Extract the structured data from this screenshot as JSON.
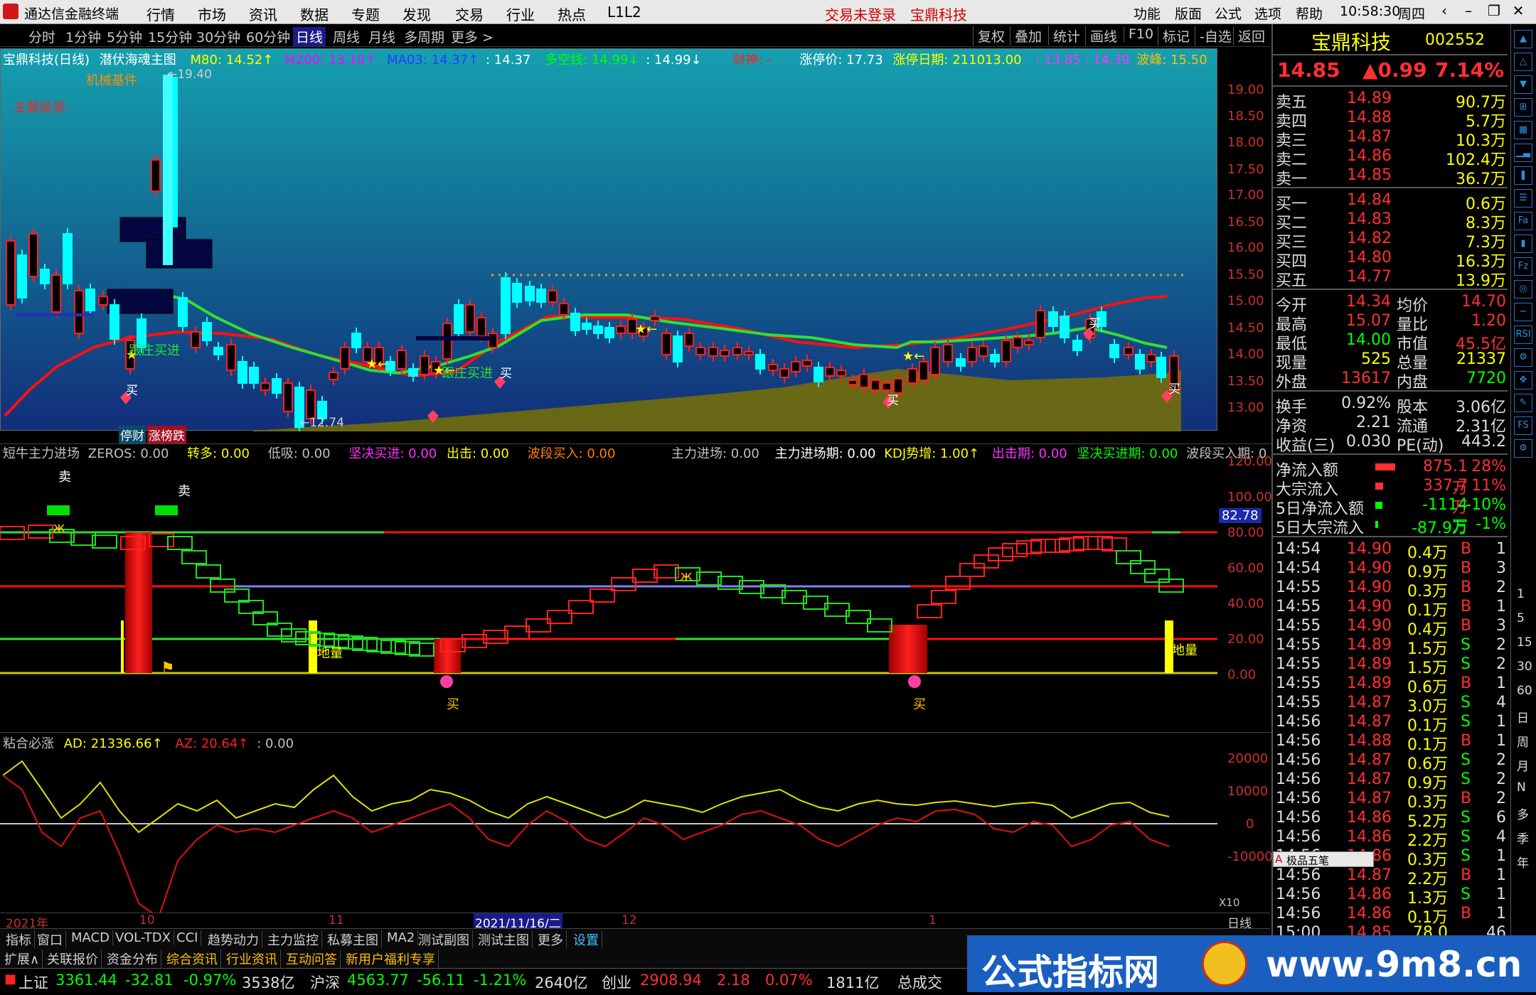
{
  "titlebar": {
    "app_name": "通达信金融终端",
    "menus": [
      "行情",
      "市场",
      "资讯",
      "数据",
      "专题",
      "发现",
      "交易",
      "行业",
      "热点",
      "L1L2"
    ],
    "notice": "交易未登录",
    "stock_short": "宝鼎科技",
    "right_menus": [
      "功能",
      "版面",
      "公式",
      "选项",
      "帮助"
    ],
    "time": "10:58:30",
    "weekday": "周四"
  },
  "toolbar": {
    "periods": [
      "分时",
      "1分钟",
      "5分钟",
      "15分钟",
      "30分钟",
      "60分钟",
      "日线",
      "周线",
      "月线",
      "多周期",
      "更多 >"
    ],
    "active_period": "日线",
    "right_buttons": [
      "复权",
      "叠加",
      "统计",
      "画线",
      "F10",
      "标记",
      "-自选",
      "返回"
    ]
  },
  "main": {
    "stock_title": "宝鼎科技(日线)",
    "formula": "潜伏海魂主图",
    "m80": "M80: 14.52↑",
    "m200": "M200: 13.10↑",
    "ma03": "MA03: 14.37↑",
    "v1": ": 14.37",
    "duokong": "多空线: 14.99↓",
    "v2": ": 14.99↓",
    "caishen": "财神: -",
    "zhangting": "涨停价: 17.73",
    "zhangting_date": "涨停日期: 211013.00",
    "range": ": 13.85 : 14.39",
    "bofeng": "波峰: 15.50",
    "label_jixie": "机械基件",
    "label_zhuti": "主题投资:",
    "label_high": "←19.40",
    "label_low": "←12.74",
    "label_track1": "跟庄买进",
    "label_track2": "跟庄买进",
    "label_buy": "买",
    "label_stop": "停财",
    "label_rank": "涨榜跌",
    "y_ticks": [
      "19.00",
      "18.50",
      "18.00",
      "17.50",
      "17.00",
      "16.50",
      "16.00",
      "15.50",
      "15.00",
      "14.50",
      "14.00",
      "13.50",
      "13.00"
    ]
  },
  "sub1": {
    "title": "短牛主力进场",
    "items": [
      "ZEROS: 0.00",
      "转多: 0.00",
      "低吸: 0.00",
      "坚决买进: 0.00",
      "出击: 0.00",
      "波段买入: 0.00",
      "主力进场: 0.00",
      "主力进场期: 0.00",
      "KDJ势增: 1.00↑",
      "出击期: 0.00",
      "坚决买进期: 0.00",
      "波段买入期: 0"
    ],
    "y_ticks": [
      "120.00",
      "100.00",
      "80.00",
      "60.00",
      "40.00",
      "20.00",
      "0.00"
    ],
    "current_value": "82.78",
    "sell_label": "卖",
    "buy_label": "买",
    "dig_label": "地量"
  },
  "sub2": {
    "title": "粘合必涨",
    "ad": "AD: 21336.66↑",
    "az": "AZ: 20.64↑",
    "extra": ": 0.00",
    "y_ticks": [
      "20000",
      "10000",
      "0",
      "-10000"
    ],
    "unit": "X10"
  },
  "timeaxis": {
    "labels": [
      "2021年",
      "10",
      "11",
      "2021/11/16/二",
      "12",
      "1"
    ],
    "period": "日线"
  },
  "tabs1": [
    "指标",
    "窗口",
    "MACD",
    "VOL-TDX",
    "CCI",
    "趋势动力",
    "主力监控",
    "私募主图",
    "MA2",
    "测试副图",
    "测试主图",
    "更多",
    "设置"
  ],
  "tabs2": [
    "扩展∧",
    "关联报价",
    "资金分布",
    "综合资讯",
    "行业资讯",
    "互动问答",
    "新用户福利专享"
  ],
  "status": {
    "sh_name": "上证",
    "sh_val": "3361.44",
    "sh_chg": "-32.81",
    "sh_pct": "-0.97%",
    "sh_amt": "3538亿",
    "hs_name": "沪深",
    "hs_val": "4563.77",
    "hs_chg": "-56.11",
    "hs_pct": "-1.21%",
    "hs_amt": "2640亿",
    "cy_name": "创业",
    "cy_val": "2908.94",
    "cy_chg": "2.18",
    "cy_pct": "0.07%",
    "cy_amt": "1811亿",
    "total": "总成交"
  },
  "quote": {
    "name": "宝鼎科技",
    "code": "002552",
    "price": "14.85",
    "change": "▲0.99",
    "pct": "7.14%",
    "asks": [
      {
        "label": "卖五",
        "price": "14.89",
        "vol": "90.7万"
      },
      {
        "label": "卖四",
        "price": "14.88",
        "vol": "5.7万"
      },
      {
        "label": "卖三",
        "price": "14.87",
        "vol": "10.3万"
      },
      {
        "label": "卖二",
        "price": "14.86",
        "vol": "102.4万"
      },
      {
        "label": "卖一",
        "price": "14.85",
        "vol": "36.7万"
      }
    ],
    "bids": [
      {
        "label": "买一",
        "price": "14.84",
        "vol": "0.6万"
      },
      {
        "label": "买二",
        "price": "14.83",
        "vol": "8.3万"
      },
      {
        "label": "买三",
        "price": "14.82",
        "vol": "7.3万"
      },
      {
        "label": "买四",
        "price": "14.80",
        "vol": "16.3万"
      },
      {
        "label": "买五",
        "price": "14.77",
        "vol": "13.9万"
      }
    ],
    "stats": [
      {
        "l1": "今开",
        "v1": "14.34",
        "l2": "均价",
        "v2": "14.70"
      },
      {
        "l1": "最高",
        "v1": "15.07",
        "l2": "量比",
        "v2": "1.20"
      },
      {
        "l1": "最低",
        "v1": "14.00",
        "l2": "市值",
        "v2": "45.5亿"
      },
      {
        "l1": "现量",
        "v1": "525",
        "l2": "总量",
        "v2": "21337"
      },
      {
        "l1": "外盘",
        "v1": "13617",
        "l2": "内盘",
        "v2": "7720"
      }
    ],
    "stats2": [
      {
        "l1": "换手",
        "v1": "0.92%",
        "l2": "股本",
        "v2": "3.06亿"
      },
      {
        "l1": "净资",
        "v1": "2.21",
        "l2": "流通",
        "v2": "2.31亿"
      },
      {
        "l1": "收益(三)",
        "v1": "0.030",
        "l2": "PE(动)",
        "v2": "443.2"
      }
    ],
    "flows": [
      {
        "label": "净流入额",
        "val": "875.1万",
        "pct": "28%",
        "bar": 0.28
      },
      {
        "label": "大宗流入",
        "val": "337.7万",
        "pct": "11%",
        "bar": 0.11
      },
      {
        "label": "5日净流入额",
        "val": "-1114万",
        "pct": "-10%",
        "bar": 0.1
      },
      {
        "label": "5日大宗流入",
        "val": "-87.9万",
        "pct": "-1%",
        "bar": 0.01
      }
    ],
    "ticks": [
      {
        "t": "14:54",
        "p": "14.90",
        "v": "0.4万",
        "d": "B",
        "n": "1"
      },
      {
        "t": "14:54",
        "p": "14.90",
        "v": "0.9万",
        "d": "B",
        "n": "3"
      },
      {
        "t": "14:55",
        "p": "14.90",
        "v": "0.3万",
        "d": "B",
        "n": "2"
      },
      {
        "t": "14:55",
        "p": "14.90",
        "v": "0.1万",
        "d": "B",
        "n": "1"
      },
      {
        "t": "14:55",
        "p": "14.90",
        "v": "0.4万",
        "d": "B",
        "n": "3"
      },
      {
        "t": "14:55",
        "p": "14.89",
        "v": "1.5万",
        "d": "S",
        "n": "2"
      },
      {
        "t": "14:55",
        "p": "14.89",
        "v": "1.5万",
        "d": "S",
        "n": "2"
      },
      {
        "t": "14:55",
        "p": "14.89",
        "v": "0.6万",
        "d": "B",
        "n": "1"
      },
      {
        "t": "14:55",
        "p": "14.87",
        "v": "3.0万",
        "d": "S",
        "n": "4"
      },
      {
        "t": "14:56",
        "p": "14.87",
        "v": "0.1万",
        "d": "S",
        "n": "1"
      },
      {
        "t": "14:56",
        "p": "14.88",
        "v": "0.1万",
        "d": "B",
        "n": "1"
      },
      {
        "t": "14:56",
        "p": "14.87",
        "v": "0.6万",
        "d": "S",
        "n": "2"
      },
      {
        "t": "14:56",
        "p": "14.87",
        "v": "0.9万",
        "d": "S",
        "n": "2"
      },
      {
        "t": "14:56",
        "p": "14.87",
        "v": "0.3万",
        "d": "B",
        "n": "2"
      },
      {
        "t": "14:56",
        "p": "14.86",
        "v": "5.2万",
        "d": "S",
        "n": "6"
      },
      {
        "t": "14:56",
        "p": "14.86",
        "v": "2.2万",
        "d": "S",
        "n": "4"
      },
      {
        "t": "14:56",
        "p": "14.86",
        "v": "0.3万",
        "d": "S",
        "n": "1"
      },
      {
        "t": "14:56",
        "p": "14.87",
        "v": "2.2万",
        "d": "B",
        "n": "1"
      },
      {
        "t": "14:56",
        "p": "14.86",
        "v": "1.3万",
        "d": "S",
        "n": "1"
      },
      {
        "t": "14:56",
        "p": "14.86",
        "v": "0.1万",
        "d": "B",
        "n": "1"
      },
      {
        "t": "15:00",
        "p": "14.85",
        "v": "78.0万",
        "d": "",
        "n": "46"
      }
    ],
    "popup": "极品五笔"
  },
  "iconbar": {
    "icons": [
      "arrow-up-icon",
      "arrow-up-icon",
      "arrow-down-icon",
      "grid-icon",
      "table-icon",
      "chart-icon",
      "candle-icon",
      "list-icon",
      "fa-icon",
      "bars-icon",
      "fz-icon",
      "circle-icon",
      "chart2-icon",
      "rsi-icon",
      "bot-icon",
      "move-icon",
      "pen-icon",
      "fs-icon",
      "gear-icon"
    ],
    "labels": [
      "1",
      "5",
      "15",
      "30",
      "60",
      "日",
      "周",
      "月",
      "N",
      "多",
      "季",
      "年"
    ]
  },
  "watermark": {
    "left": "公式指标网",
    "right": "www.9m8.cn"
  },
  "colors": {
    "up": "#ff3030",
    "down": "#00ff00",
    "yellow": "#ffff00",
    "cyan": "#00ffff"
  }
}
